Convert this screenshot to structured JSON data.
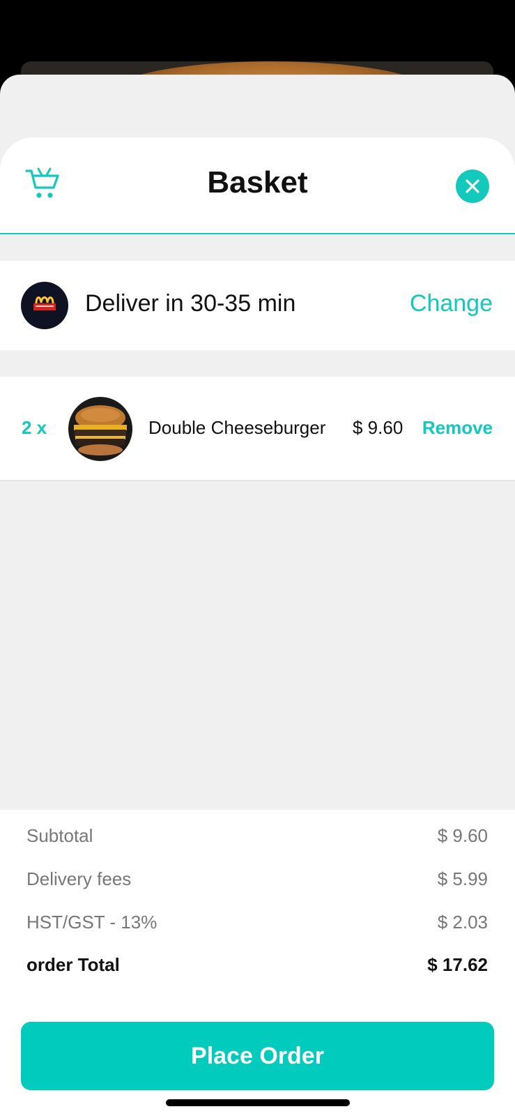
{
  "header": {
    "title": "Basket",
    "cart_icon": "shopping-cart-icon",
    "close_icon": "close-icon"
  },
  "delivery": {
    "text": "Deliver in 30-35 min",
    "change_label": "Change",
    "restaurant_logo": "mcdonalds-logo"
  },
  "items": [
    {
      "quantity": "2 x",
      "name": "Double Cheeseburger",
      "price": "$ 9.60",
      "remove_label": "Remove"
    }
  ],
  "summary": {
    "subtotal_label": "Subtotal",
    "subtotal_value": "$ 9.60",
    "delivery_label": "Delivery fees",
    "delivery_value": "$ 5.99",
    "tax_label": "HST/GST - 13%",
    "tax_value": "$ 2.03",
    "total_label": "order Total",
    "total_value": "$ 17.62"
  },
  "actions": {
    "place_order_label": "Place Order"
  },
  "colors": {
    "accent": "#12c9bb",
    "button": "#00cbbd",
    "sheet_bg": "#f0f0f0"
  }
}
